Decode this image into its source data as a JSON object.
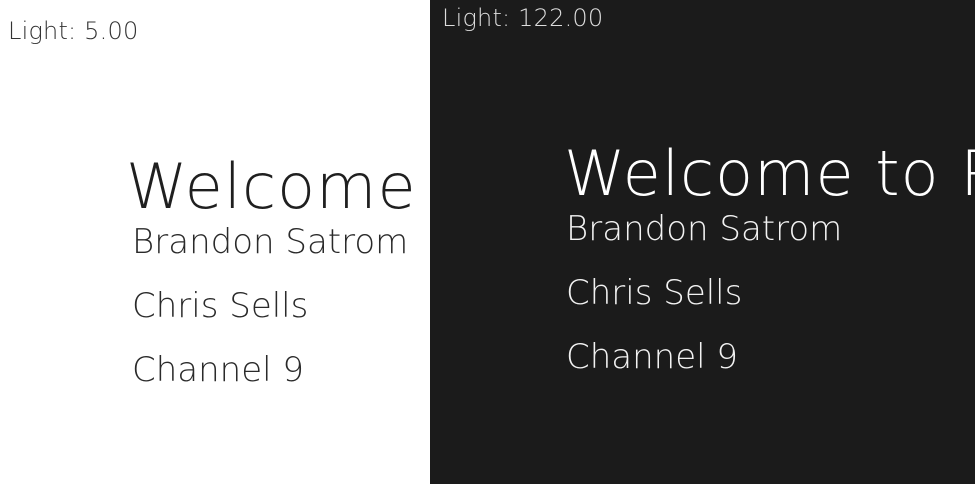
{
  "light_panel": {
    "light_reading": "Light: 5.00",
    "title": "Welcome to Rs",
    "items": [
      {
        "label": "Brandon Satrom"
      },
      {
        "label": "Chris Sells"
      },
      {
        "label": "Channel 9"
      }
    ]
  },
  "dark_panel": {
    "light_reading": "Light: 122.00",
    "title": "Welcome to Rs",
    "items": [
      {
        "label": "Brandon Satrom"
      },
      {
        "label": "Chris Sells"
      },
      {
        "label": "Channel 9"
      }
    ]
  },
  "colors": {
    "light_background": "#ffffff",
    "dark_background": "#1b1b1b"
  }
}
